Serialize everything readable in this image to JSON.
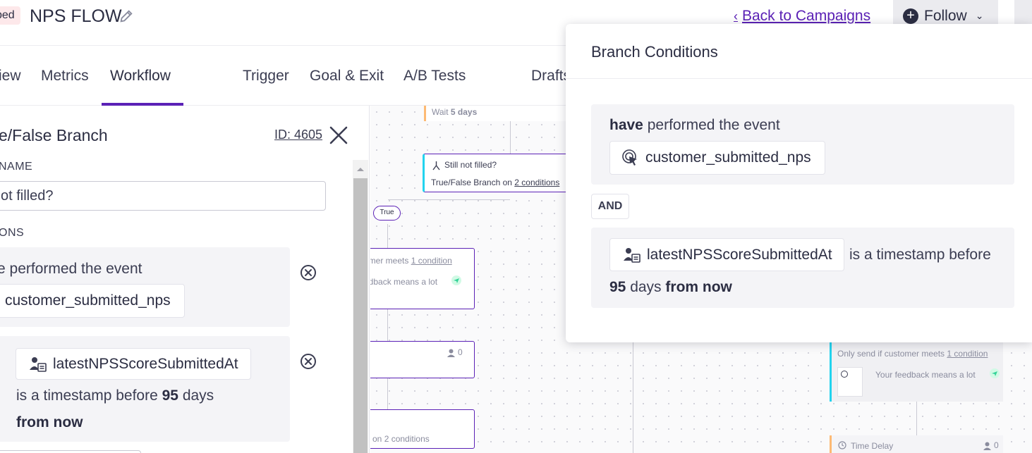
{
  "header": {
    "status_badge": "ped",
    "title": "NPS FLOW",
    "back_link": "Back to Campaigns",
    "follow_label": "Follow"
  },
  "tabs": [
    {
      "label": "iew"
    },
    {
      "label": "Metrics"
    },
    {
      "label": "Workflow"
    },
    {
      "label": "Trigger"
    },
    {
      "label": "Goal & Exit"
    },
    {
      "label": "A/B Tests"
    },
    {
      "label": "Drafts"
    }
  ],
  "panel": {
    "title": "e/False Branch",
    "id_label": "ID: 4605",
    "name_label": "NAME",
    "name_value": "ot filled?",
    "conditions_label": "ONS",
    "cond1_text": "e performed the event",
    "cond1_event": "customer_submitted_nps",
    "cond2_attr": "latestNPSScoreSubmittedAt",
    "cond2_text_a": "is a timestamp before",
    "cond2_num": "95",
    "cond2_text_b": "days",
    "cond2_text_c": "from now"
  },
  "canvas": {
    "wait_prefix": "Wait",
    "wait_value": "5 days",
    "branch_title": "Still not filled?",
    "branch_sub_a": "True/False Branch on",
    "branch_sub_link": "2 conditions",
    "true_label": "True",
    "node_a_line1_a": "omer meets",
    "node_a_line1_link": "1 condition",
    "node_a_line2": "edback means a lot",
    "node_b_count": "0",
    "node_c_text_a": "on",
    "node_c_link": "2 conditions",
    "node_d_line1_a": "Only send if customer meets",
    "node_d_line1_link": "1 condition",
    "node_d_line2": "Your feedback means a lot",
    "node_e_label": "Time Delay",
    "node_e_count": "0"
  },
  "popover": {
    "title": "Branch Conditions",
    "c1_bold": "have",
    "c1_text": "performed the event",
    "c1_event": "customer_submitted_nps",
    "and_label": "AND",
    "c2_attr": "latestNPSScoreSubmittedAt",
    "c2_text": "is a timestamp before",
    "c2_num": "95",
    "c2_days": "days",
    "c2_bold": "from now"
  },
  "colors": {
    "accent": "#5b21b6",
    "text": "#2b2d42",
    "badge_bg": "#fde8ea",
    "cyan_edge": "#22d3ee",
    "orange_edge": "#fdba74"
  },
  "icons": [
    "pencil-icon",
    "chevron-left-icon",
    "plus-circle-icon",
    "chevron-down-icon",
    "close-icon",
    "remove-circle-icon",
    "cursor-click-icon",
    "person-attribute-icon",
    "branch-icon",
    "message-icon",
    "send-icon",
    "person-icon",
    "clock-icon"
  ]
}
